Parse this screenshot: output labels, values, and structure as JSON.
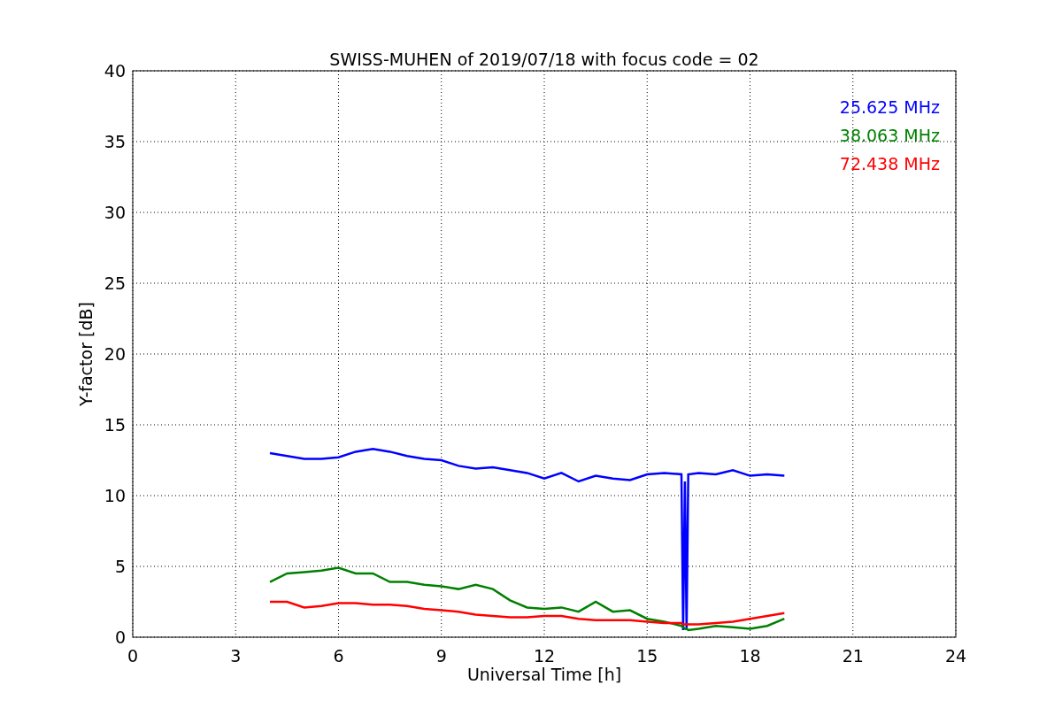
{
  "chart_data": {
    "type": "line",
    "title": "SWISS-MUHEN of 2019/07/18 with focus code = 02",
    "xlabel": "Universal Time [h]",
    "ylabel": "Y-factor [dB]",
    "x": [
      4,
      4.5,
      5,
      5.5,
      6,
      6.5,
      7,
      7.5,
      8,
      8.5,
      9,
      9.5,
      10,
      10.5,
      11,
      11.5,
      12,
      12.5,
      13,
      13.5,
      14,
      14.5,
      15,
      15.5,
      16,
      16.05,
      16.1,
      16.15,
      16.2,
      16.5,
      17,
      17.5,
      18,
      18.5,
      19
    ],
    "series": [
      {
        "name": "25.625 MHz",
        "color": "#0000ff",
        "values": [
          13,
          12.8,
          12.6,
          12.6,
          12.7,
          13.1,
          13.3,
          13.1,
          12.8,
          12.6,
          12.5,
          12.1,
          11.9,
          12.0,
          11.8,
          11.6,
          11.2,
          11.6,
          11.0,
          11.4,
          11.2,
          11.1,
          11.5,
          11.6,
          11.5,
          0.5,
          11,
          0.5,
          11.5,
          11.6,
          11.5,
          11.8,
          11.4,
          11.5,
          11.4
        ]
      },
      {
        "name": "38.063 MHz",
        "color": "#008000",
        "values": [
          3.9,
          4.5,
          4.6,
          4.7,
          4.9,
          4.5,
          4.5,
          3.9,
          3.9,
          3.7,
          3.6,
          3.4,
          3.7,
          3.4,
          2.6,
          2.1,
          2.0,
          2.1,
          1.8,
          2.5,
          1.8,
          1.9,
          1.3,
          1.1,
          0.8,
          0.7,
          0.6,
          0.6,
          0.5,
          0.6,
          0.8,
          0.7,
          0.6,
          0.8,
          1.3
        ]
      },
      {
        "name": "72.438 MHz",
        "color": "#ff0000",
        "values": [
          2.5,
          2.5,
          2.1,
          2.2,
          2.4,
          2.4,
          2.3,
          2.3,
          2.2,
          2.0,
          1.9,
          1.8,
          1.6,
          1.5,
          1.4,
          1.4,
          1.5,
          1.5,
          1.3,
          1.2,
          1.2,
          1.2,
          1.1,
          1.0,
          1.0,
          0.9,
          0.9,
          0.9,
          0.9,
          0.9,
          1.0,
          1.1,
          1.3,
          1.5,
          1.7
        ]
      }
    ],
    "grid": true,
    "xlim": [
      0,
      24
    ],
    "ylim": [
      0,
      40
    ],
    "xticks": [
      0,
      3,
      6,
      9,
      12,
      15,
      18,
      21,
      24
    ],
    "yticks": [
      0,
      5,
      10,
      15,
      20,
      25,
      30,
      35,
      40
    ]
  }
}
